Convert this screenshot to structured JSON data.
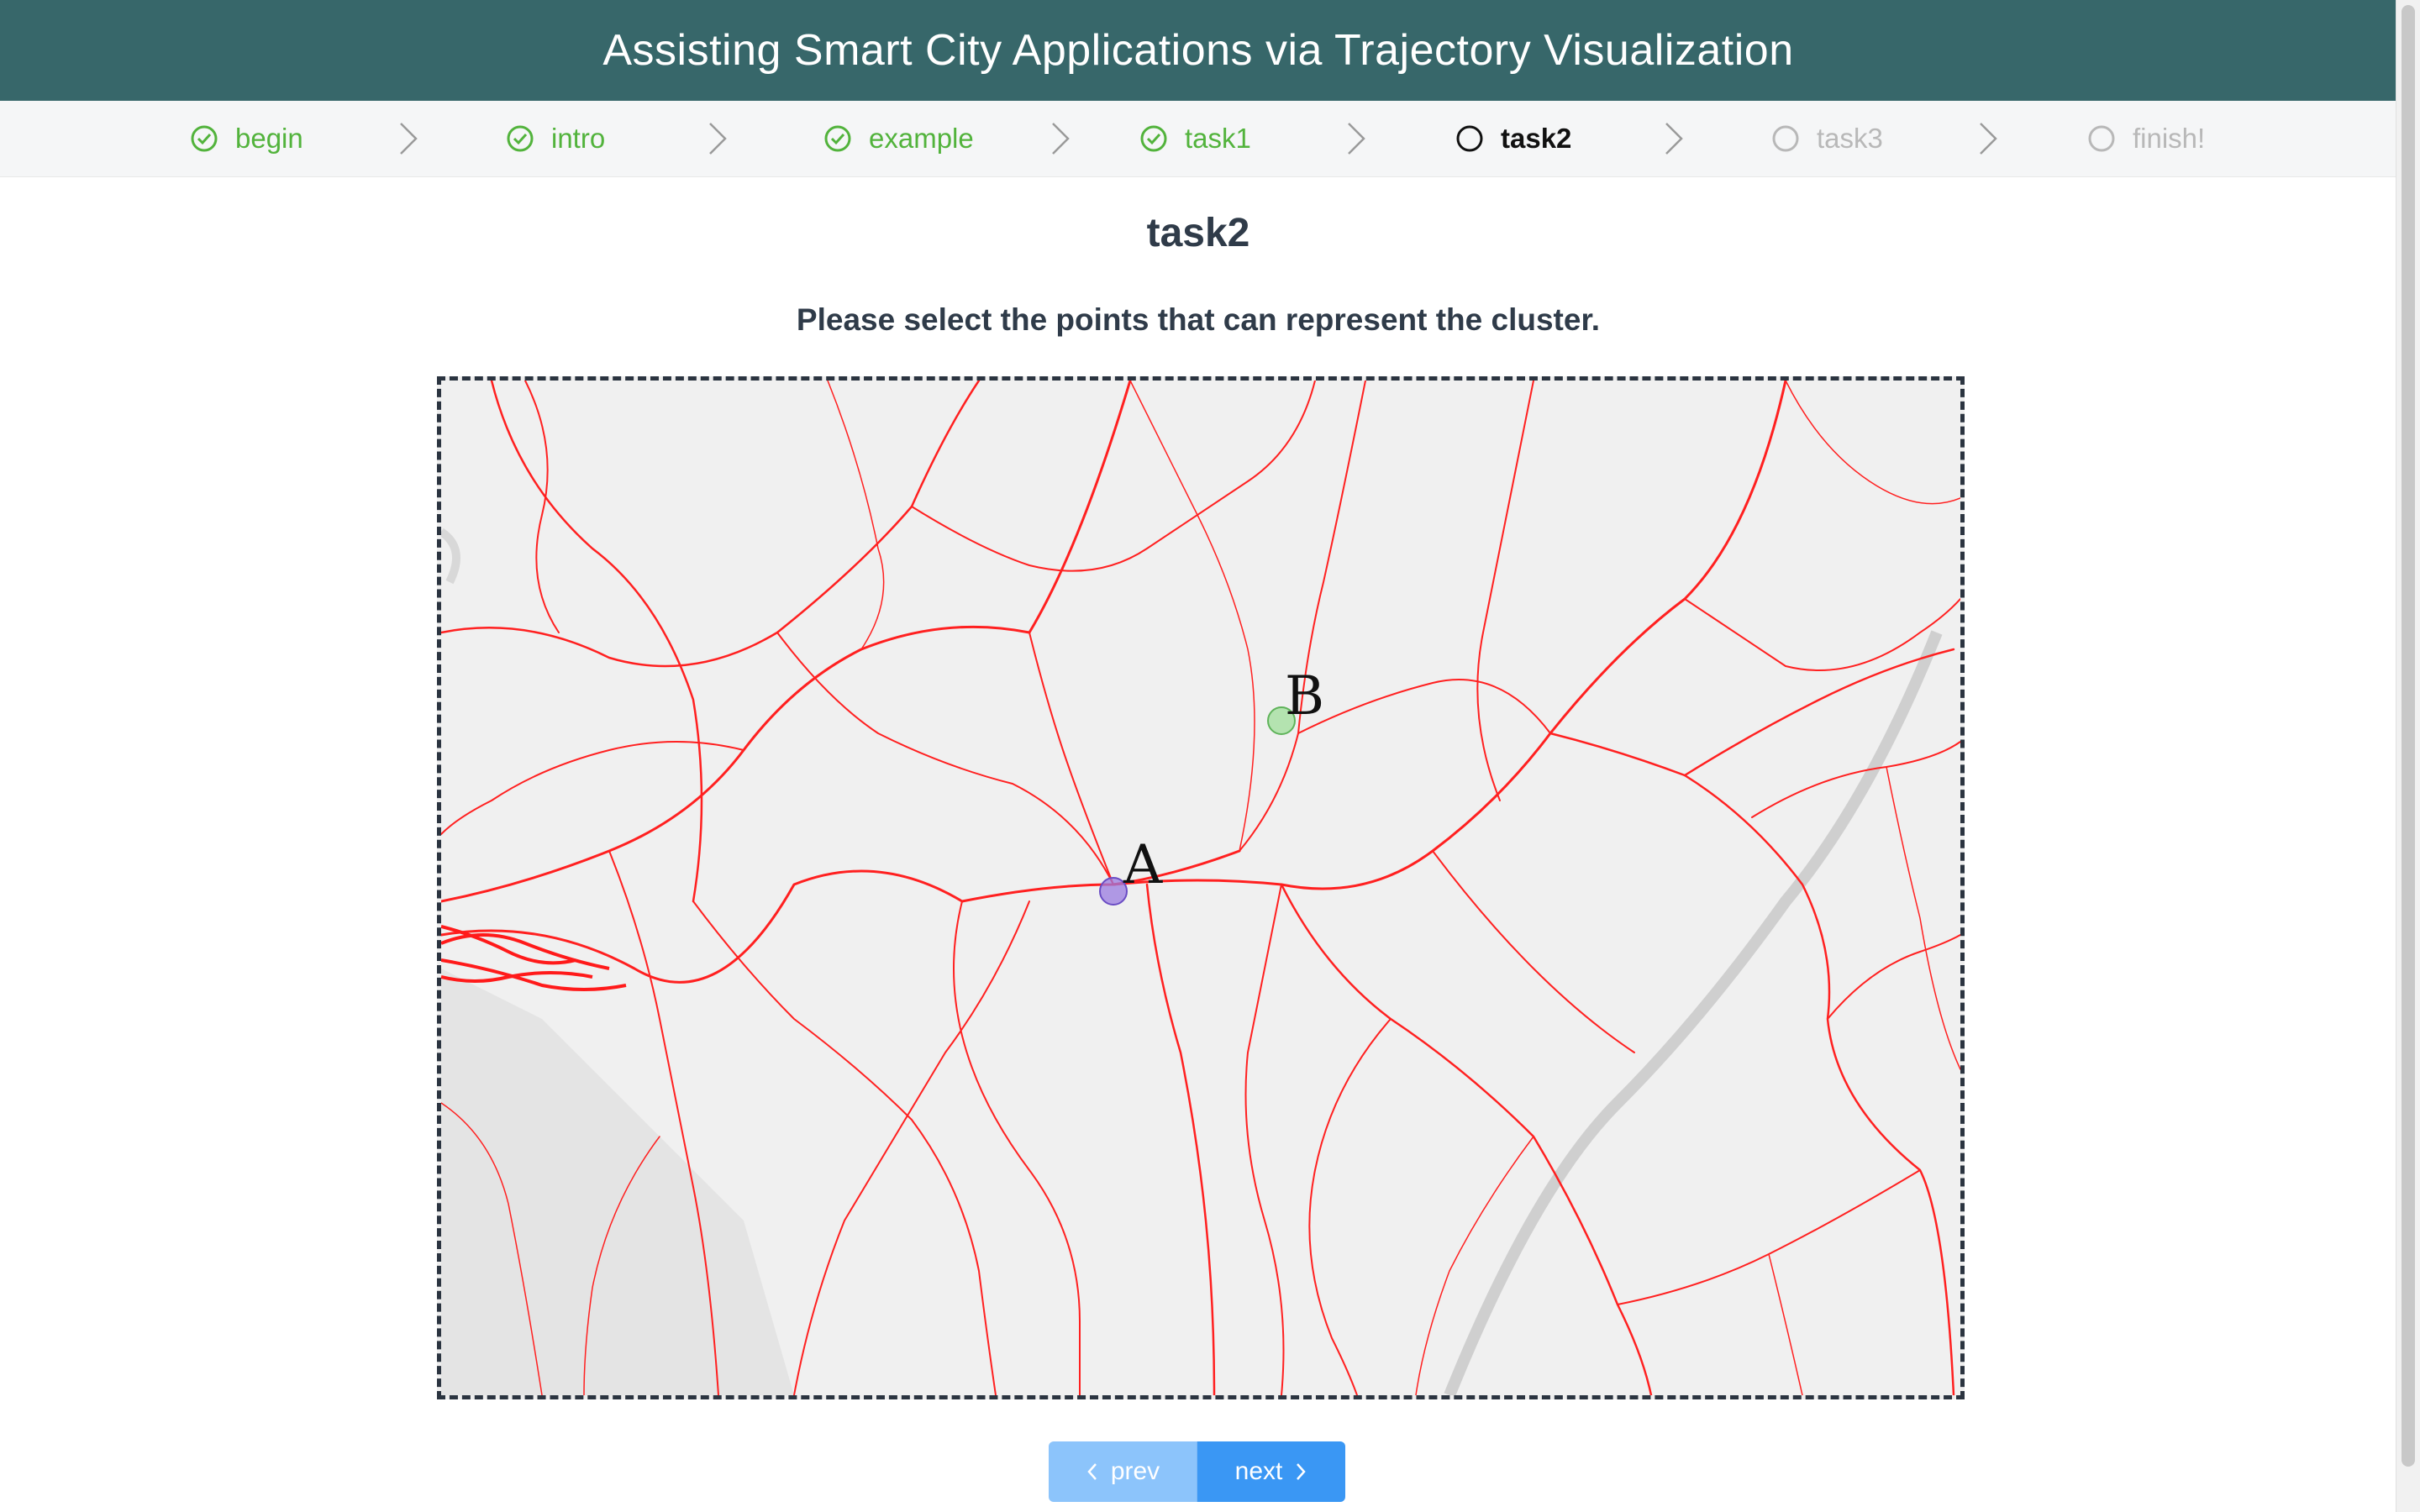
{
  "header": {
    "title": "Assisting Smart City Applications via Trajectory Visualization"
  },
  "steps": [
    {
      "label": "begin",
      "status": "done"
    },
    {
      "label": "intro",
      "status": "done"
    },
    {
      "label": "example",
      "status": "done"
    },
    {
      "label": "task1",
      "status": "done"
    },
    {
      "label": "task2",
      "status": "current"
    },
    {
      "label": "task3",
      "status": "wait"
    },
    {
      "label": "finish!",
      "status": "wait"
    }
  ],
  "task": {
    "title": "task2",
    "instruction": "Please select the points that can represent the cluster."
  },
  "map": {
    "markers": [
      {
        "label": "A",
        "color": "#7b5fd6"
      },
      {
        "label": "B",
        "color": "#8fd68c"
      }
    ],
    "trajectory_color": "#ff2020"
  },
  "nav": {
    "prev_label": "prev",
    "next_label": "next"
  },
  "colors": {
    "header_bg": "#37676a",
    "done": "#52b33c",
    "wait": "#b8b8b8",
    "primary": "#3a97f4"
  }
}
